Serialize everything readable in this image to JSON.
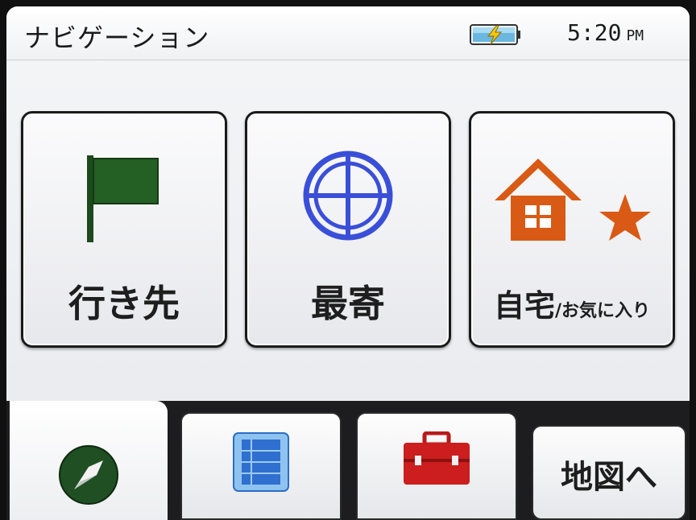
{
  "header": {
    "title": "ナビゲーション",
    "time": "5:20",
    "ampm": "PM",
    "battery_icon": "battery-charging-icon"
  },
  "main_buttons": [
    {
      "id": "destination",
      "label": "行き先",
      "icon": "flag-icon",
      "icon_color": "#1f5a1f"
    },
    {
      "id": "nearby",
      "label": "最寄",
      "icon": "crosshair-icon",
      "icon_color": "#3a4fd8"
    },
    {
      "id": "home_favorites",
      "label": "自宅",
      "label_small": "/お気に入り",
      "icon": "house-star-icon",
      "icon_color": "#d85a14"
    }
  ],
  "bottom_tabs": [
    {
      "id": "navigation",
      "icon": "compass-icon",
      "selected": true
    },
    {
      "id": "list",
      "icon": "list-icon",
      "selected": false
    },
    {
      "id": "tools",
      "icon": "toolbox-icon",
      "selected": false
    },
    {
      "id": "map",
      "label": "地図へ",
      "selected": false
    }
  ],
  "colors": {
    "accent_green": "#1f5a1f",
    "accent_blue": "#3a4fd8",
    "accent_orange": "#d85a14",
    "toolbox_red": "#cc1e1e"
  }
}
